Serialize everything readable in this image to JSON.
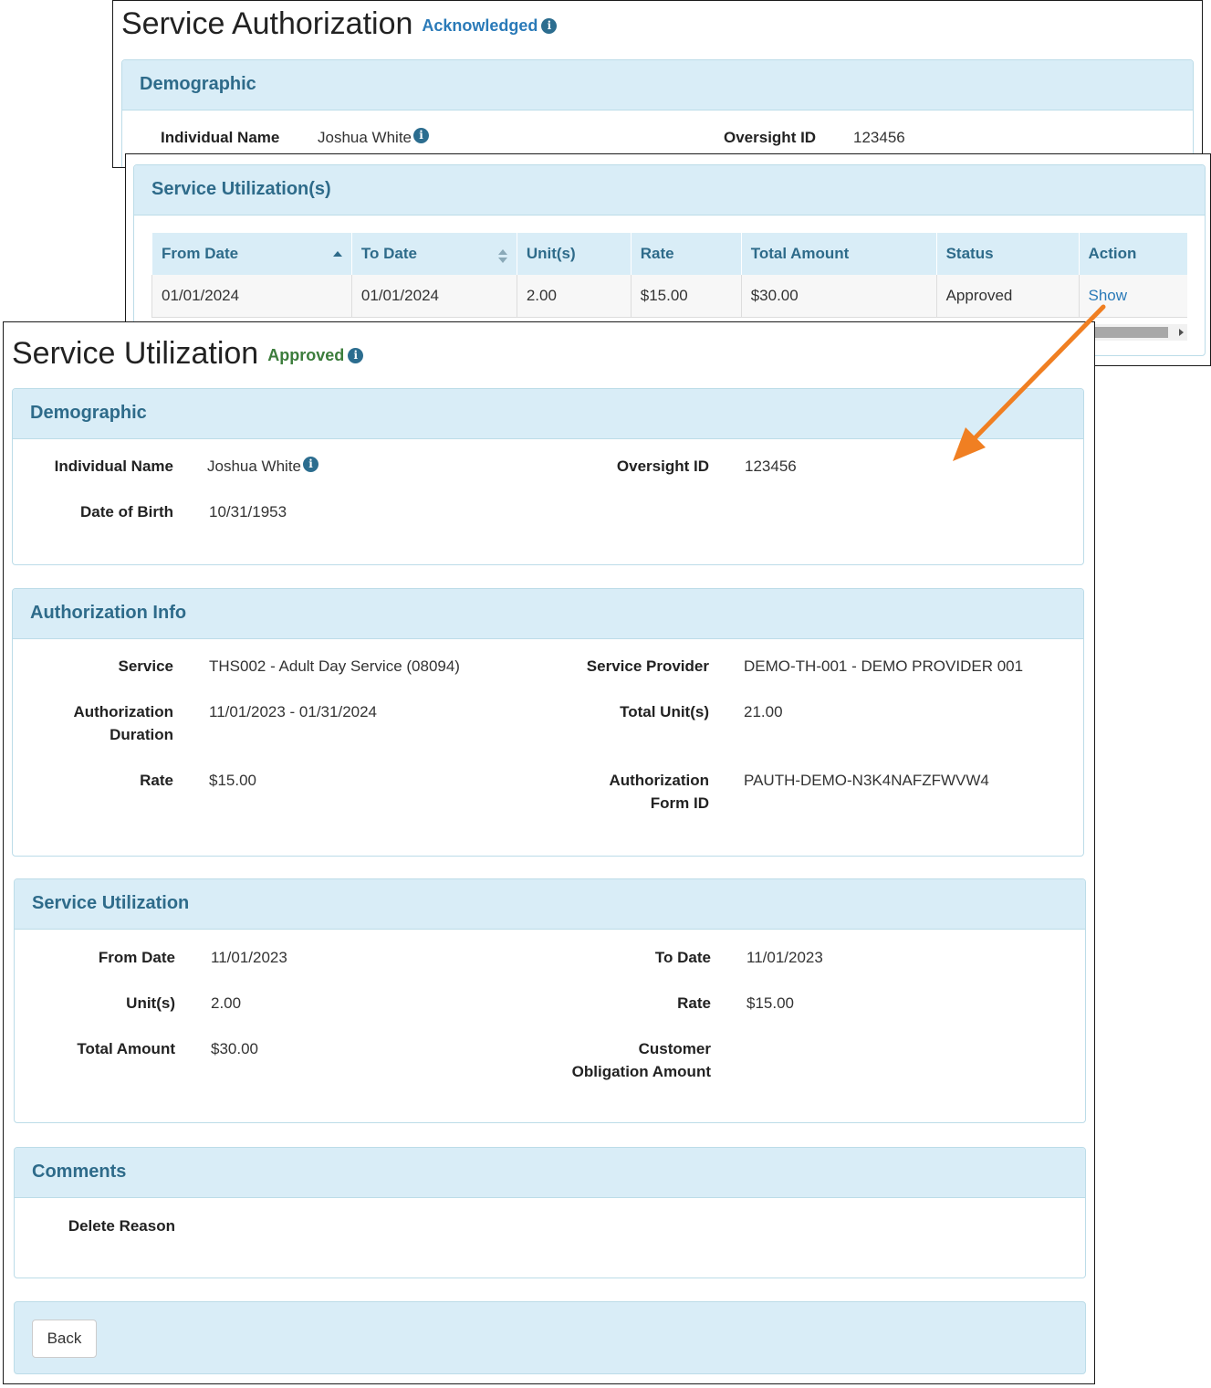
{
  "auth": {
    "title": "Service Authorization",
    "status": "Acknowledged",
    "demographic": {
      "heading": "Demographic",
      "individual_name_label": "Individual Name",
      "individual_name": "Joshua White",
      "oversight_id_label": "Oversight ID",
      "oversight_id": "123456"
    }
  },
  "utilizations": {
    "heading": "Service Utilization(s)",
    "columns": [
      "From Date",
      "To Date",
      "Unit(s)",
      "Rate",
      "Total Amount",
      "Status",
      "Action"
    ],
    "rows": [
      {
        "from_date": "01/01/2024",
        "to_date": "01/01/2024",
        "units": "2.00",
        "rate": "$15.00",
        "total_amount": "$30.00",
        "status": "Approved",
        "action": "Show"
      }
    ]
  },
  "detail": {
    "title": "Service Utilization",
    "status": "Approved",
    "demographic": {
      "heading": "Demographic",
      "individual_name_label": "Individual Name",
      "individual_name": "Joshua White",
      "oversight_id_label": "Oversight ID",
      "oversight_id": "123456",
      "dob_label": "Date of Birth",
      "dob": "10/31/1953"
    },
    "authorization_info": {
      "heading": "Authorization Info",
      "service_label": "Service",
      "service": "THS002 - Adult Day Service (08094)",
      "provider_label": "Service Provider",
      "provider": "DEMO-TH-001 - DEMO PROVIDER 001",
      "duration_label_1": "Authorization",
      "duration_label_2": "Duration",
      "duration": "11/01/2023 - 01/31/2024",
      "total_units_label": "Total Unit(s)",
      "total_units": "21.00",
      "rate_label": "Rate",
      "rate": "$15.00",
      "form_id_label_1": "Authorization",
      "form_id_label_2": "Form ID",
      "form_id": "PAUTH-DEMO-N3K4NAFZFWVW4"
    },
    "service_utilization": {
      "heading": "Service Utilization",
      "from_date_label": "From Date",
      "from_date": "11/01/2023",
      "to_date_label": "To Date",
      "to_date": "11/01/2023",
      "units_label": "Unit(s)",
      "units": "2.00",
      "rate_label": "Rate",
      "rate": "$15.00",
      "total_amount_label": "Total Amount",
      "total_amount": "$30.00",
      "customer_obligation_label_1": "Customer",
      "customer_obligation_label_2": "Obligation Amount"
    },
    "comments": {
      "heading": "Comments",
      "delete_reason_label": "Delete Reason"
    },
    "back_label": "Back"
  },
  "colors": {
    "panel_header_bg": "#d9edf7",
    "panel_header_text": "#2e6b8a",
    "acknowledged": "#2a7ab8",
    "approved": "#3c7d3c",
    "link": "#2a7ab8",
    "arrow": "#f07f22"
  },
  "icons": [
    "info-icon",
    "sort-asc-icon",
    "sort-both-icon",
    "scroll-right-icon",
    "arrow-icon"
  ]
}
